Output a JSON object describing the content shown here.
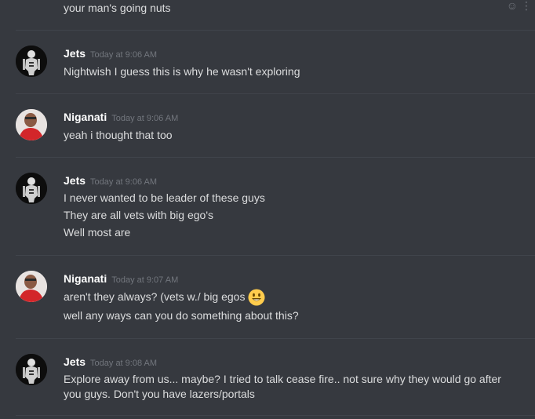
{
  "top_fragment": "your man's going nuts",
  "messages": [
    {
      "author": "Jets",
      "avatar": "skull-avatar",
      "time": "Today at 9:06 AM",
      "lines": [
        "Nightwish I guess this is why he wasn't exploring"
      ]
    },
    {
      "author": "Niganati",
      "avatar": "red-shirt-avatar",
      "time": "Today at 9:06 AM",
      "lines": [
        "yeah i thought that too"
      ]
    },
    {
      "author": "Jets",
      "avatar": "skull-avatar",
      "time": "Today at 9:06 AM",
      "lines": [
        "I never wanted to be leader of these guys",
        "They are all vets with big ego's",
        "Well most are"
      ]
    },
    {
      "author": "Niganati",
      "avatar": "red-shirt-avatar",
      "time": "Today at 9:07 AM",
      "lines": [
        "aren't they always? (vets w./ big egos",
        "well any ways can you do something about this?"
      ]
    },
    {
      "author": "Jets",
      "avatar": "skull-avatar",
      "time": "Today at 9:08 AM",
      "lines": [
        "Explore away from us... maybe? I tried to talk cease fire.. not sure why they would go after",
        "you guys. Don't you have lazers/portals"
      ]
    }
  ],
  "icons": {
    "emoji_picker": "add-reaction-icon",
    "more": "more-options-icon",
    "inline_emoji": "smiley-emoji-icon"
  },
  "colors": {
    "background": "#36393f",
    "username": "#ffffff",
    "timestamp": "#72767d",
    "text": "#dcddde",
    "divider": "#40444b"
  }
}
